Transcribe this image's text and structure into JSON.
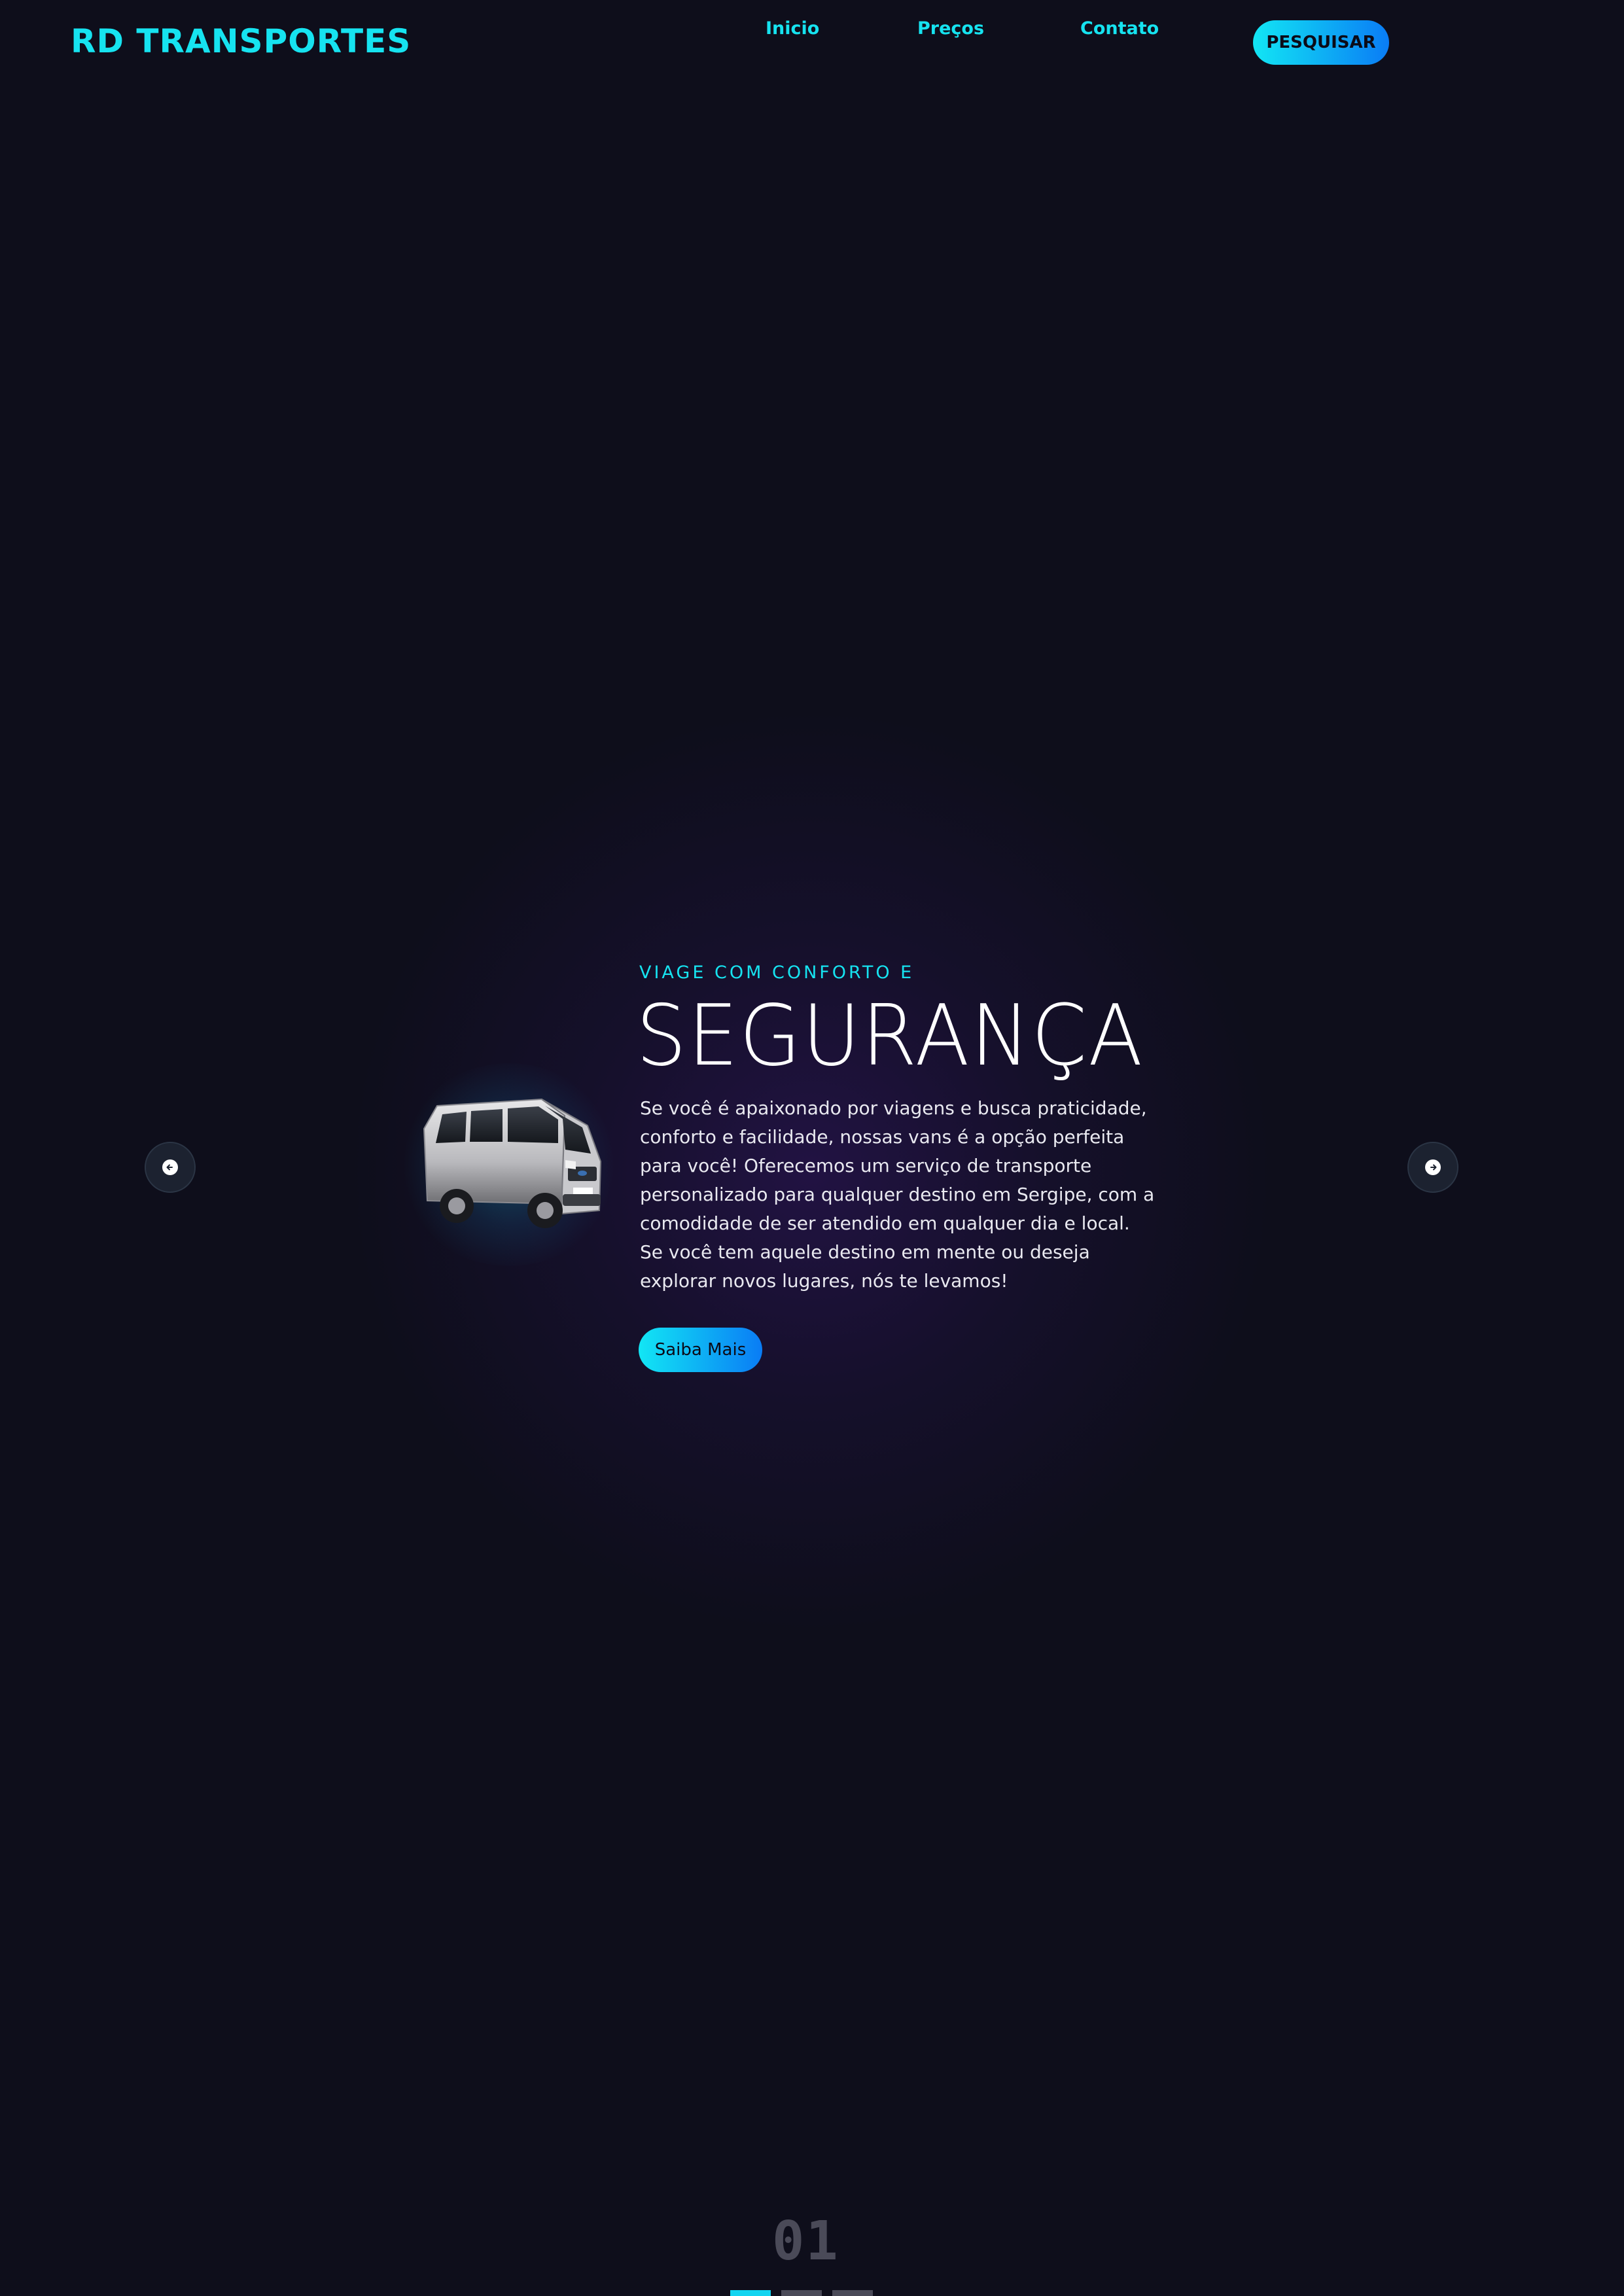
{
  "header": {
    "brand": "RD TRANSPORTES",
    "nav": [
      {
        "label": "Inicio"
      },
      {
        "label": "Preços"
      },
      {
        "label": "Contato"
      }
    ],
    "search_label": "PESQUISAR"
  },
  "hero": {
    "eyebrow": "VIAGE COM CONFORTO E",
    "headline": "SEGURANÇA",
    "description": "Se você é apaixonado por viagens e busca praticidade, conforto e facilidade, nossas vans é a opção perfeita para você! Oferecemos um serviço de transporte personalizado para qualquer destino em Sergipe, com a comodidade de ser atendido em qualquer dia e local. Se você tem aquele destino em mente ou deseja explorar novos lugares, nós te levamos!",
    "cta_label": "Saiba Mais",
    "image": "van-image"
  },
  "carousel": {
    "prev_icon": "arrow-left-icon",
    "next_icon": "arrow-right-icon",
    "counter": "01",
    "slide_count": 3,
    "active_index": 0
  },
  "colors": {
    "background": "#0e0e1b",
    "accent": "#16e3f0",
    "accent_gradient_end": "#0a7cf5",
    "text": "#ffffff",
    "muted": "#4a4a58"
  }
}
